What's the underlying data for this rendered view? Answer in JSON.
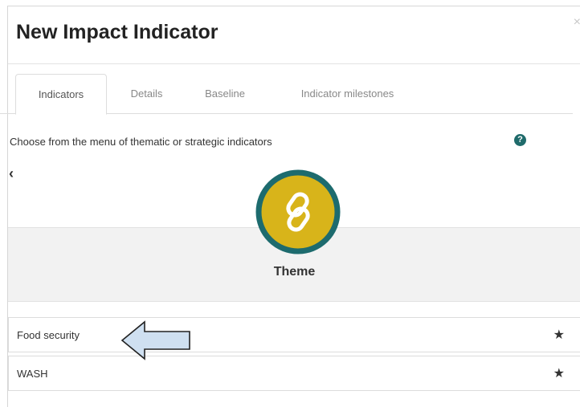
{
  "modal": {
    "title": "New Impact Indicator",
    "close_label": "×"
  },
  "tabs": [
    {
      "label": "Indicators",
      "active": true
    },
    {
      "label": "Details",
      "active": false
    },
    {
      "label": "Baseline",
      "active": false
    },
    {
      "label": "Indicator milestones",
      "active": false
    }
  ],
  "help": {
    "text": "Choose from the menu of thematic or strategic indicators",
    "icon_glyph": "?"
  },
  "back": {
    "glyph": "‹"
  },
  "theme": {
    "label": "Theme",
    "icon": "link-icon"
  },
  "items": [
    {
      "label": "Food security",
      "star": "★"
    },
    {
      "label": "WASH",
      "star": "★"
    }
  ],
  "colors": {
    "theme_circle_fill": "#d8b41a",
    "theme_circle_ring": "#1d6b6e",
    "help_icon": "#1f6b6b",
    "arrow_fill": "#cfe0f1",
    "arrow_stroke": "#222222"
  }
}
